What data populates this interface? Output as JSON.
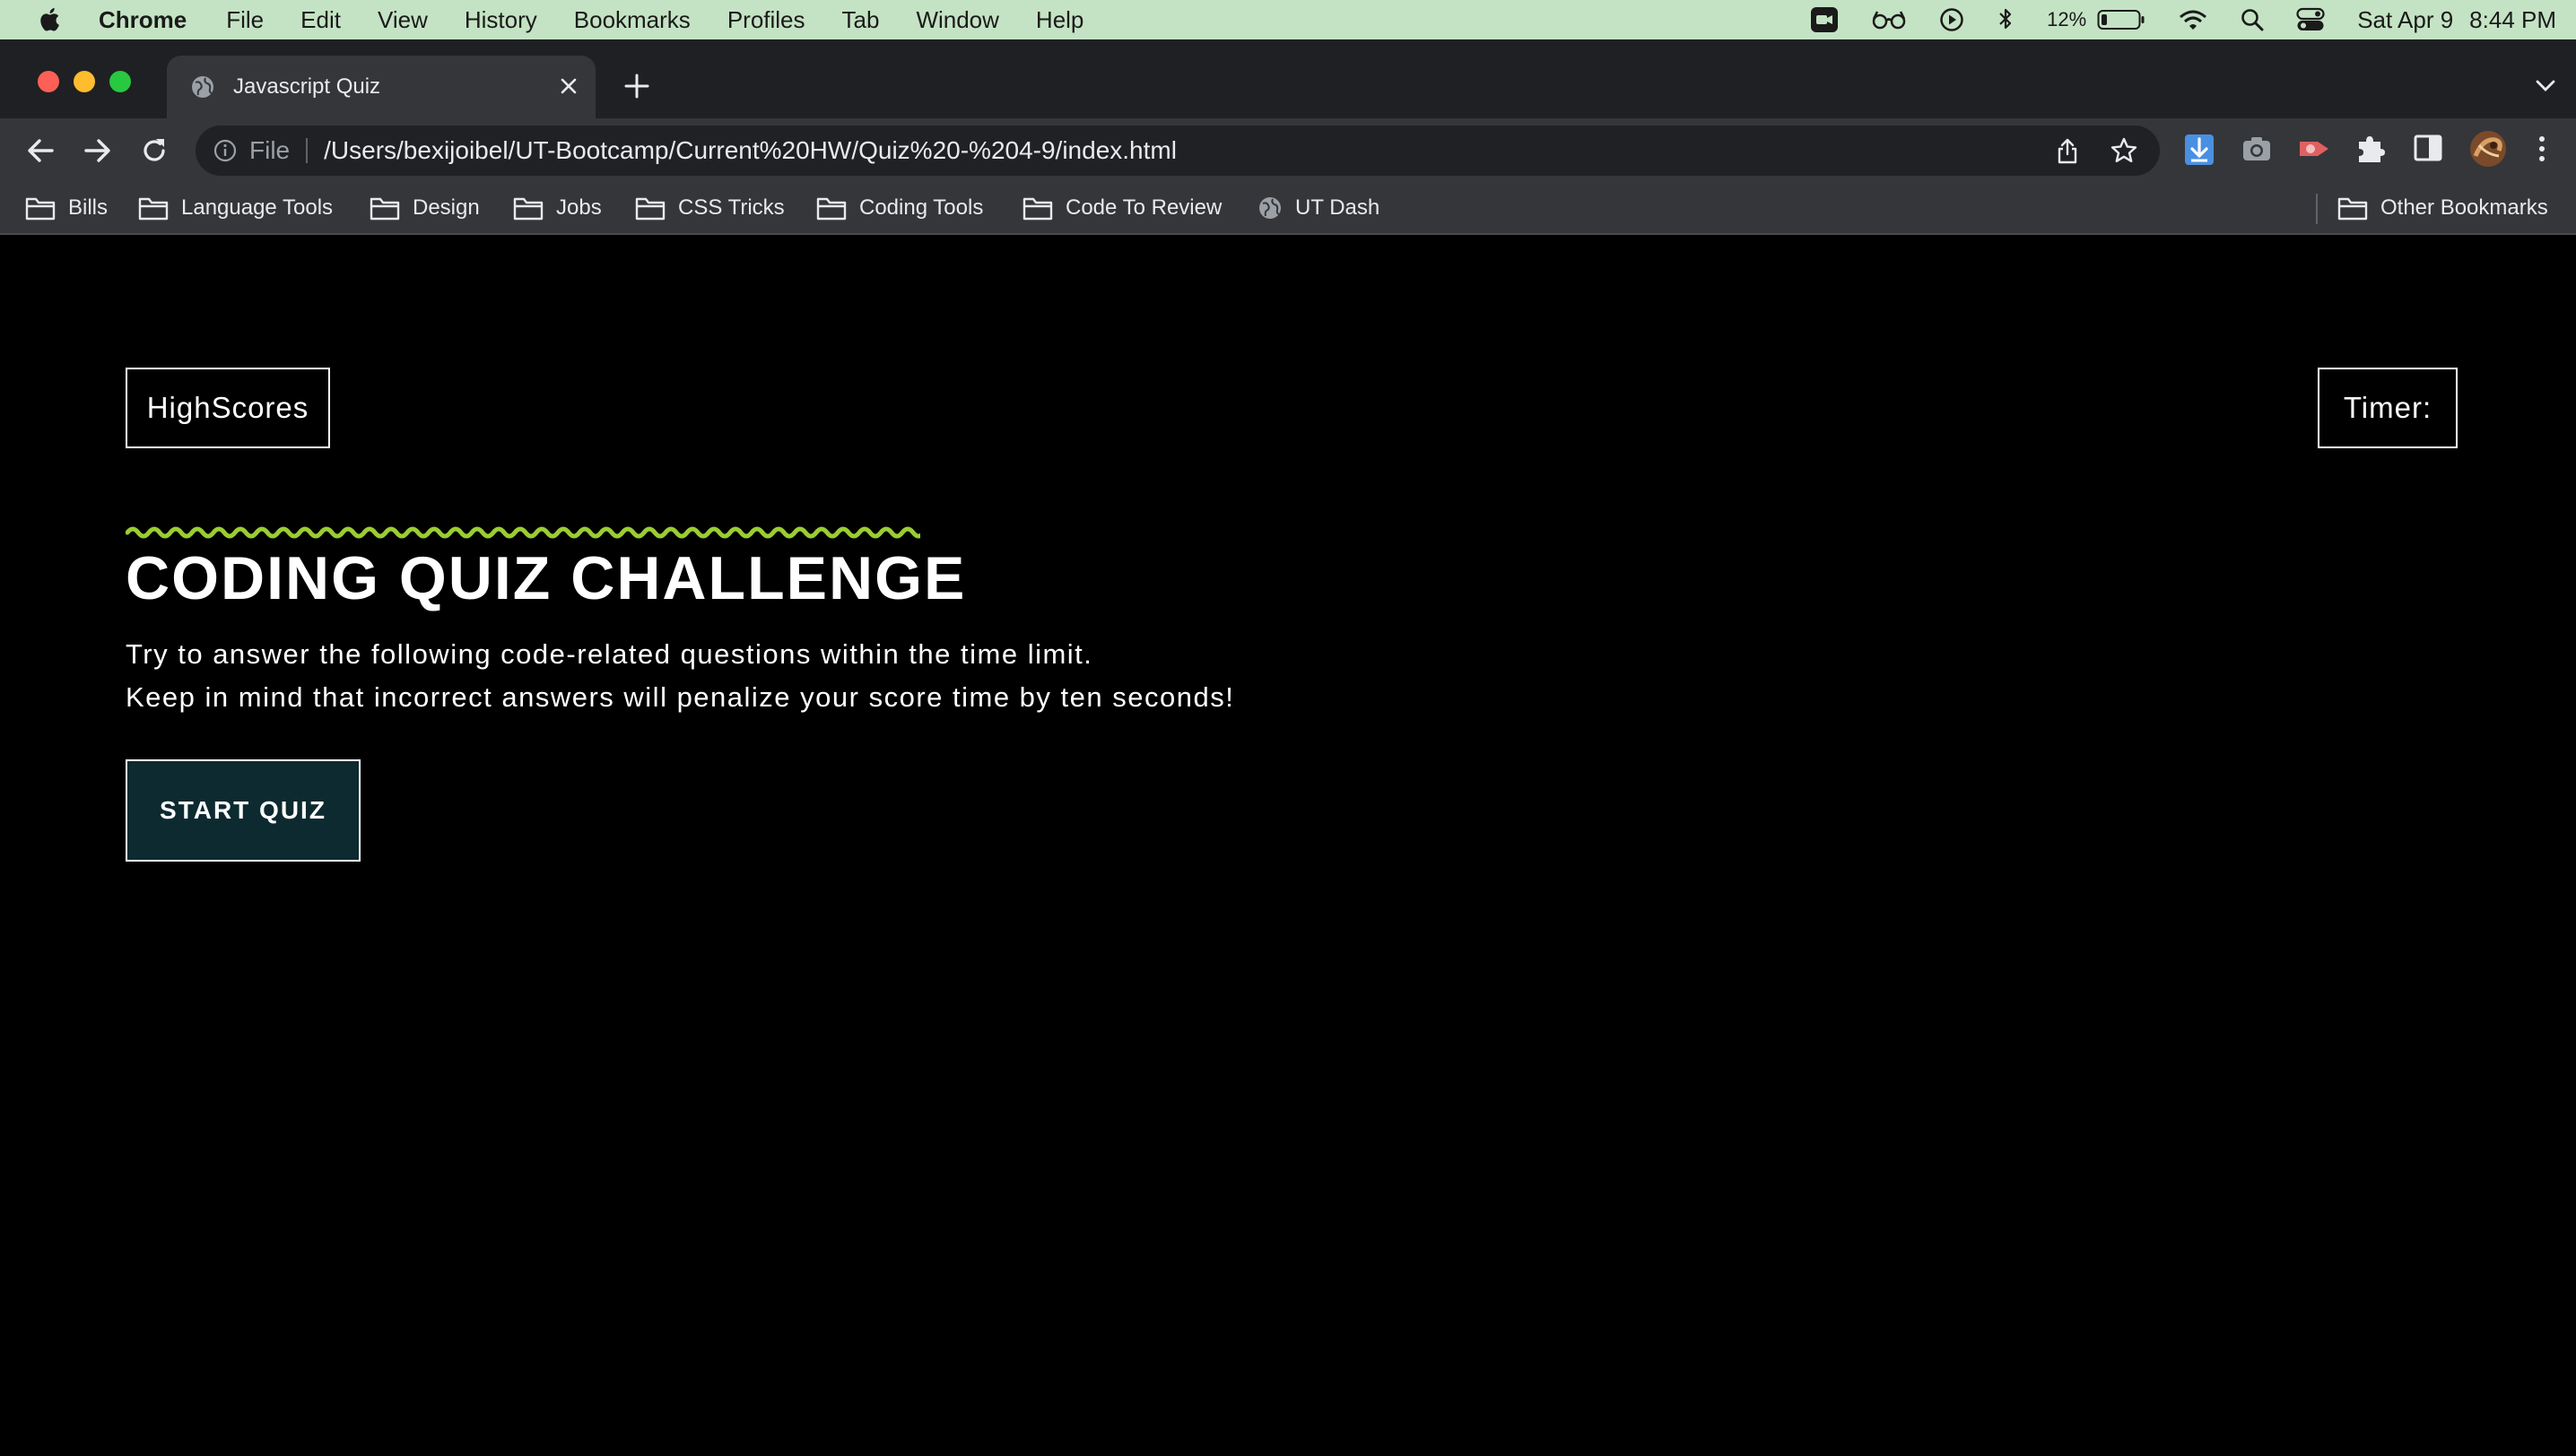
{
  "menubar": {
    "app_name": "Chrome",
    "menus": [
      "File",
      "Edit",
      "View",
      "History",
      "Bookmarks",
      "Profiles",
      "Tab",
      "Window",
      "Help"
    ],
    "battery_percent": "12%",
    "date": "Sat Apr 9",
    "time": "8:44 PM",
    "background_color": "#c4e3c4"
  },
  "browser": {
    "tab_title": "Javascript Quiz",
    "address_scheme": "File",
    "address_url": "/Users/bexijoibel/UT-Bootcamp/Current%20HW/Quiz%20-%204-9/index.html",
    "bookmarks": [
      "Bills",
      "Language Tools",
      "Design",
      "Jobs",
      "CSS Tricks",
      "Coding Tools",
      "Code To Review",
      "UT Dash"
    ],
    "other_bookmarks": "Other Bookmarks"
  },
  "page": {
    "highscores_label": "HighScores",
    "timer_label": "Timer:",
    "title": "CODING QUIZ CHALLENGE",
    "description_line1": "Try to answer the following code-related questions within the time limit.",
    "description_line2": "Keep in mind that incorrect answers will penalize your score time by ten seconds!",
    "start_button_label": "START QUIZ",
    "accent_color": "#9acd32",
    "start_button_color": "#0d2a30"
  }
}
